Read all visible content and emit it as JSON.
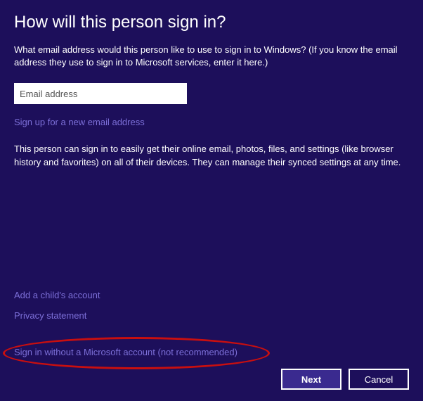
{
  "title": "How will this person sign in?",
  "intro": "What email address would this person like to use to sign in to Windows? (If you know the email address they use to sign in to Microsoft services, enter it here.)",
  "email": {
    "placeholder": "Email address",
    "value": ""
  },
  "links": {
    "signup": "Sign up for a new email address",
    "add_child": "Add a child's account",
    "privacy": "Privacy statement",
    "no_account": "Sign in without a Microsoft account (not recommended)"
  },
  "description": "This person can sign in to easily get their online email, photos, files, and settings (like browser history and favorites) on all of their devices. They can manage their synced settings at any time.",
  "buttons": {
    "next": "Next",
    "cancel": "Cancel"
  }
}
